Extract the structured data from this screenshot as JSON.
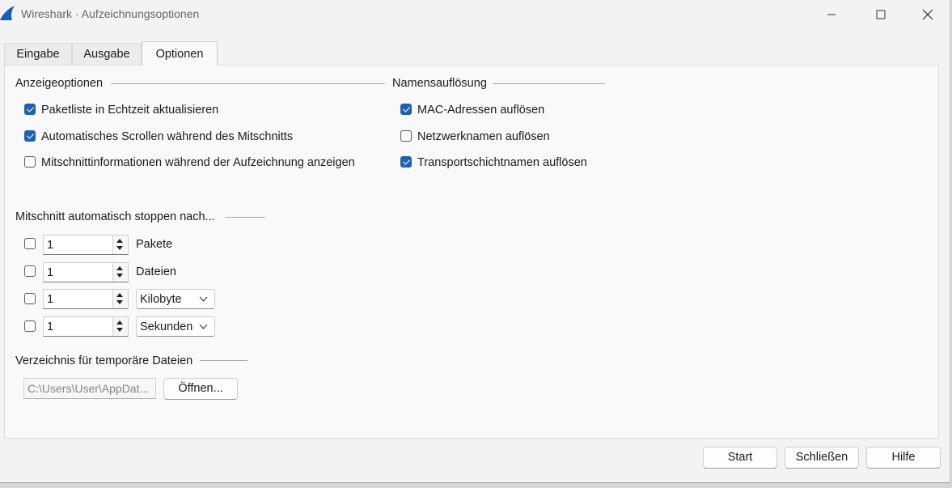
{
  "window": {
    "title": "Wireshark · Aufzeichnungsoptionen"
  },
  "tabs": [
    {
      "label": "Eingabe",
      "active": false
    },
    {
      "label": "Ausgabe",
      "active": false
    },
    {
      "label": "Optionen",
      "active": true
    }
  ],
  "display_options": {
    "title": "Anzeigeoptionen",
    "items": [
      {
        "label": "Paketliste in Echtzeit aktualisieren",
        "checked": true
      },
      {
        "label": "Automatisches Scrollen während des Mitschnitts",
        "checked": true
      },
      {
        "label": "Mitschnittinformationen während der Aufzeichnung anzeigen",
        "checked": false
      }
    ]
  },
  "name_resolution": {
    "title": "Namensauflösung",
    "items": [
      {
        "label": "MAC-Adressen auflösen",
        "checked": true
      },
      {
        "label": "Netzwerknamen auflösen",
        "checked": false
      },
      {
        "label": "Transportschichtnamen auflösen",
        "checked": true
      }
    ]
  },
  "auto_stop": {
    "title": "Mitschnitt automatisch stoppen nach...",
    "rows": [
      {
        "checked": false,
        "value": "1",
        "unit": "Pakete"
      },
      {
        "checked": false,
        "value": "1",
        "unit": "Dateien"
      },
      {
        "checked": false,
        "value": "1",
        "unit": "Kilobyte"
      },
      {
        "checked": false,
        "value": "1",
        "unit": "Sekunden"
      }
    ]
  },
  "temp_dir": {
    "title": "Verzeichnis für temporäre Dateien",
    "path_value": "C:\\Users\\User\\AppDat...",
    "open_button": "Öffnen..."
  },
  "footer": {
    "start": "Start",
    "close": "Schließen",
    "help": "Hilfe"
  },
  "colors": {
    "accent": "#1f5fb0",
    "shark_fin": "#1560bd"
  },
  "icons": {
    "app": "wireshark-fin-icon",
    "minimize": "minimize-icon",
    "maximize": "maximize-icon",
    "close": "close-icon",
    "spin_up": "arrow-up-icon",
    "spin_down": "arrow-down-icon",
    "dropdown": "chevron-down-icon"
  }
}
